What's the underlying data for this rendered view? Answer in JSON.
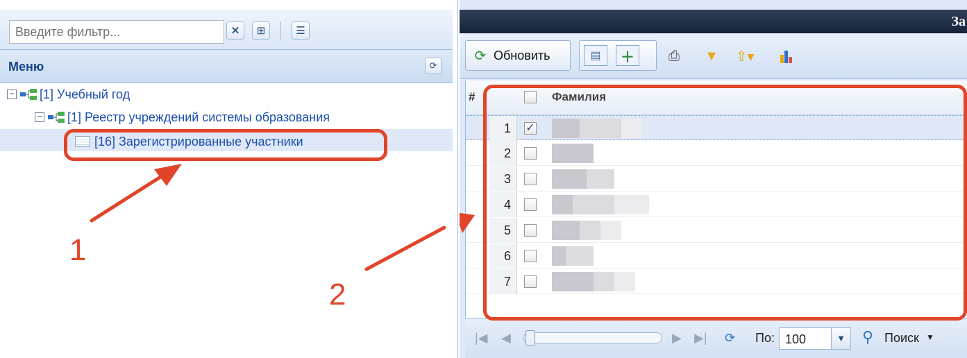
{
  "left_panel": {
    "filter": {
      "placeholder": "Введите фильтр...",
      "value": ""
    },
    "menu_title": "Меню",
    "tree": [
      {
        "label": "[1] Учебный год"
      },
      {
        "label": "[1] Реестр учреждений системы образования"
      },
      {
        "label": "[16] Зарегистрированные участники"
      }
    ]
  },
  "right_panel": {
    "title": "За",
    "toolbar": {
      "refresh_label": "Обновить"
    },
    "grid": {
      "headers": {
        "rownum": "#",
        "surname": "Фамилия"
      },
      "rows": [
        {
          "num": "1",
          "checked": true
        },
        {
          "num": "2",
          "checked": false
        },
        {
          "num": "3",
          "checked": false
        },
        {
          "num": "4",
          "checked": false
        },
        {
          "num": "5",
          "checked": false
        },
        {
          "num": "6",
          "checked": false
        },
        {
          "num": "7",
          "checked": false
        }
      ]
    },
    "pager": {
      "per_page_label": "По:",
      "per_page_value": "100",
      "search_label": "Поиск"
    }
  },
  "annotations": {
    "label_1": "1",
    "label_2": "2",
    "color": "#e0452a"
  }
}
